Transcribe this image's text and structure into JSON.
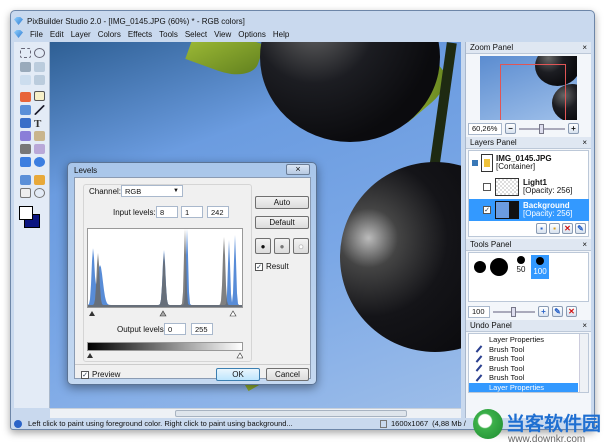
{
  "window": {
    "title": "PixBuilder Studio 2.0 - [IMG_0145.JPG (60%) * - RGB colors]"
  },
  "menu": [
    "File",
    "Edit",
    "Layer",
    "Colors",
    "Effects",
    "Tools",
    "Select",
    "View",
    "Options",
    "Help"
  ],
  "zoom_panel": {
    "title": "Zoom Panel",
    "value": "60,26%",
    "minus": "−",
    "plus": "+"
  },
  "layers_panel": {
    "title": "Layers Panel",
    "layers": [
      {
        "name": "IMG_0145.JPG",
        "info": "[Container]"
      },
      {
        "name": "Light1",
        "info": "[Opacity: 256]"
      },
      {
        "name": "Background",
        "info": "[Opacity: 256]",
        "selected": true
      }
    ]
  },
  "tools_panel": {
    "title": "Tools Panel",
    "brush_labels": [
      "50",
      "100"
    ],
    "size": "100"
  },
  "undo_panel": {
    "title": "Undo Panel",
    "items": [
      "Layer Properties",
      "Brush Tool",
      "Brush Tool",
      "Brush Tool",
      "Brush Tool",
      "Layer Properties"
    ]
  },
  "close": "×",
  "levels": {
    "title": "Levels",
    "channel_label": "Channel:",
    "channel": "RGB",
    "input_label": "Input levels:",
    "input": [
      "8",
      "1",
      "242"
    ],
    "output_label": "Output levels:",
    "output": [
      "0",
      "255"
    ],
    "auto": "Auto",
    "default": "Default",
    "result": "Result",
    "preview": "Preview",
    "ok": "OK",
    "cancel": "Cancel",
    "check": "✓"
  },
  "status": {
    "hint": "Left click to paint using foreground color. Right click to paint using background...",
    "size": "1600x1067",
    "mem": "(4,88 Mb /"
  },
  "watermark": {
    "name": "当客软件园",
    "url": "www.downkr.com"
  }
}
